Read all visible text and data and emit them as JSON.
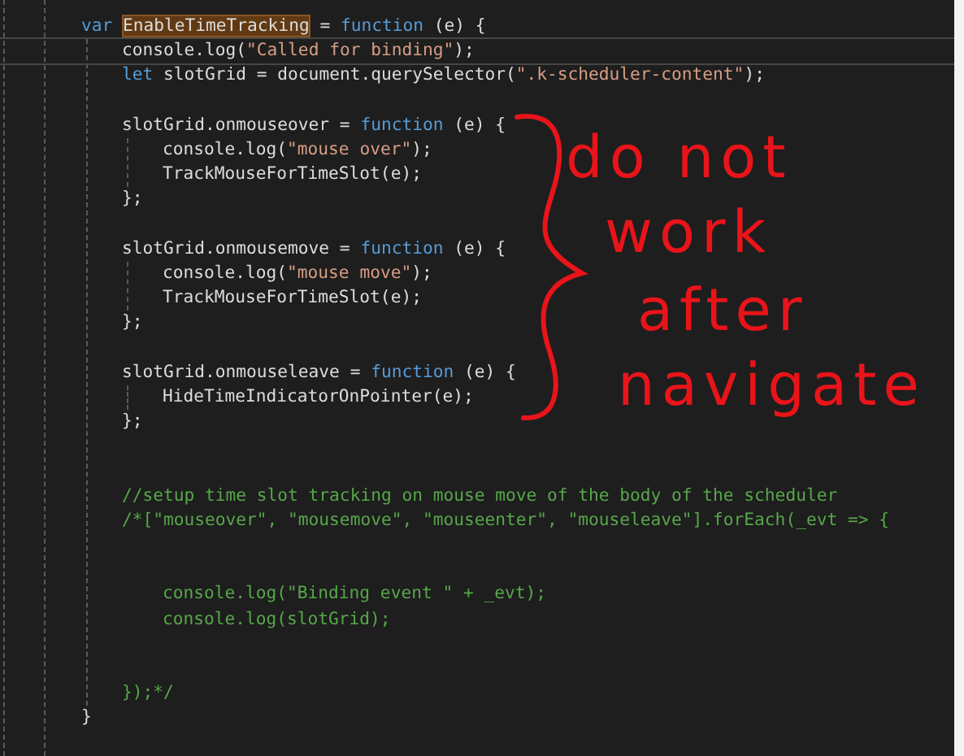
{
  "code": [
    {
      "kind": "code",
      "current": false,
      "tokens": [
        {
          "kind": "keyword",
          "text": "var ",
          "highlighted": false
        },
        {
          "kind": "plain",
          "text": "EnableTimeTracking",
          "highlighted": true
        },
        {
          "kind": "plain",
          "text": " = ",
          "highlighted": false
        },
        {
          "kind": "keyword",
          "text": "function",
          "highlighted": false
        },
        {
          "kind": "plain",
          "text": " (e) {",
          "highlighted": false
        }
      ],
      "children": [
        {
          "kind": "code",
          "current": true,
          "tokens": [
            {
              "kind": "plain",
              "text": "console.log(",
              "highlighted": false
            },
            {
              "kind": "string",
              "text": "\"Called for binding\"",
              "highlighted": false
            },
            {
              "kind": "plain",
              "text": ");",
              "highlighted": false
            }
          ]
        },
        {
          "kind": "code",
          "current": false,
          "tokens": [
            {
              "kind": "keyword",
              "text": "let",
              "highlighted": false
            },
            {
              "kind": "plain",
              "text": " slotGrid = document.querySelector(",
              "highlighted": false
            },
            {
              "kind": "string",
              "text": "\".k-scheduler-content\"",
              "highlighted": false
            },
            {
              "kind": "plain",
              "text": ");",
              "highlighted": false
            }
          ]
        },
        {
          "kind": "blank"
        },
        {
          "kind": "code",
          "current": false,
          "tokens": [
            {
              "kind": "plain",
              "text": "slotGrid.onmouseover = ",
              "highlighted": false
            },
            {
              "kind": "keyword",
              "text": "function",
              "highlighted": false
            },
            {
              "kind": "plain",
              "text": " (e) {",
              "highlighted": false
            }
          ],
          "children": [
            {
              "kind": "code",
              "current": false,
              "tokens": [
                {
                  "kind": "plain",
                  "text": "console.log(",
                  "highlighted": false
                },
                {
                  "kind": "string",
                  "text": "\"mouse over\"",
                  "highlighted": false
                },
                {
                  "kind": "plain",
                  "text": ");",
                  "highlighted": false
                }
              ]
            },
            {
              "kind": "code",
              "current": false,
              "tokens": [
                {
                  "kind": "plain",
                  "text": "TrackMouseForTimeSlot(e);",
                  "highlighted": false
                }
              ]
            }
          ]
        },
        {
          "kind": "code",
          "current": false,
          "tokens": [
            {
              "kind": "plain",
              "text": "};",
              "highlighted": false
            }
          ]
        },
        {
          "kind": "blank"
        },
        {
          "kind": "code",
          "current": false,
          "tokens": [
            {
              "kind": "plain",
              "text": "slotGrid.onmousemove = ",
              "highlighted": false
            },
            {
              "kind": "keyword",
              "text": "function",
              "highlighted": false
            },
            {
              "kind": "plain",
              "text": " (e) {",
              "highlighted": false
            }
          ],
          "children": [
            {
              "kind": "code",
              "current": false,
              "tokens": [
                {
                  "kind": "plain",
                  "text": "console.log(",
                  "highlighted": false
                },
                {
                  "kind": "string",
                  "text": "\"mouse move\"",
                  "highlighted": false
                },
                {
                  "kind": "plain",
                  "text": ");",
                  "highlighted": false
                }
              ]
            },
            {
              "kind": "code",
              "current": false,
              "tokens": [
                {
                  "kind": "plain",
                  "text": "TrackMouseForTimeSlot(e);",
                  "highlighted": false
                }
              ]
            }
          ]
        },
        {
          "kind": "code",
          "current": false,
          "tokens": [
            {
              "kind": "plain",
              "text": "};",
              "highlighted": false
            }
          ]
        },
        {
          "kind": "blank"
        },
        {
          "kind": "code",
          "current": false,
          "tokens": [
            {
              "kind": "plain",
              "text": "slotGrid.onmouseleave = ",
              "highlighted": false
            },
            {
              "kind": "keyword",
              "text": "function",
              "highlighted": false
            },
            {
              "kind": "plain",
              "text": " (e) {",
              "highlighted": false
            }
          ],
          "children": [
            {
              "kind": "code",
              "current": false,
              "tokens": [
                {
                  "kind": "plain",
                  "text": "HideTimeIndicatorOnPointer(e);",
                  "highlighted": false
                }
              ]
            }
          ]
        },
        {
          "kind": "code",
          "current": false,
          "tokens": [
            {
              "kind": "plain",
              "text": "};",
              "highlighted": false
            }
          ]
        },
        {
          "kind": "blank"
        },
        {
          "kind": "blank"
        },
        {
          "kind": "comment",
          "current": false,
          "tokens": [
            {
              "kind": "comment",
              "text": "//setup time slot tracking on mouse move of the body of the scheduler",
              "highlighted": false
            }
          ]
        },
        {
          "kind": "comment",
          "current": false,
          "tokens": [
            {
              "kind": "comment",
              "text": "/*[\"mouseover\", \"mousemove\", \"mouseenter\", \"mouseleave\"].forEach(_evt => {",
              "highlighted": false
            }
          ],
          "children": [
            {
              "kind": "blank"
            },
            {
              "kind": "blank"
            },
            {
              "kind": "comment",
              "current": false,
              "tokens": [
                {
                  "kind": "comment",
                  "text": "console.log(\"Binding event \" + _evt);",
                  "highlighted": false
                }
              ]
            },
            {
              "kind": "comment",
              "current": false,
              "tokens": [
                {
                  "kind": "comment",
                  "text": "console.log(slotGrid);",
                  "highlighted": false
                }
              ]
            },
            {
              "kind": "blank"
            },
            {
              "kind": "blank"
            }
          ]
        },
        {
          "kind": "comment",
          "current": false,
          "tokens": [
            {
              "kind": "comment",
              "text": "});*/",
              "highlighted": false
            }
          ]
        }
      ]
    },
    {
      "kind": "code",
      "current": false,
      "tokens": [
        {
          "kind": "plain",
          "text": "}",
          "highlighted": false
        }
      ]
    }
  ],
  "annotation": {
    "lines": [
      "do not",
      "work",
      "after",
      "navigate"
    ]
  }
}
